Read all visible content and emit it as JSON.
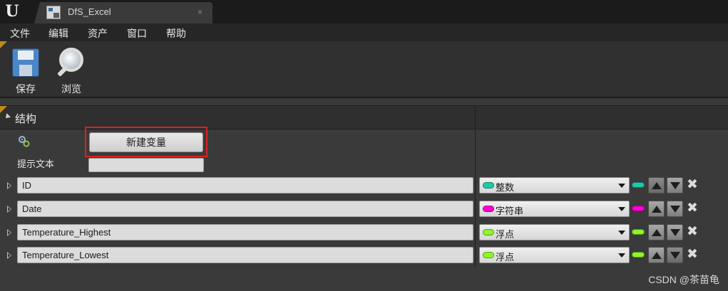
{
  "window": {
    "logo": "U",
    "tab_title": "DfS_Excel",
    "tab_close": "×"
  },
  "menu": [
    "文件",
    "编辑",
    "资产",
    "窗口",
    "帮助"
  ],
  "toolbar": {
    "save_label": "保存",
    "browse_label": "浏览"
  },
  "structure": {
    "header": "结构",
    "new_variable_button": "新建变量",
    "tooltip_label": "提示文本",
    "tooltip_value": ""
  },
  "fields": [
    {
      "name": "ID",
      "type": "整数",
      "type_color": "#1ec9a8"
    },
    {
      "name": "Date",
      "type": "字符串",
      "type_color": "#ff00d4"
    },
    {
      "name": "Temperature_Highest",
      "type": "浮点",
      "type_color": "#8ef52a"
    },
    {
      "name": "Temperature_Lowest",
      "type": "浮点",
      "type_color": "#8ef52a"
    }
  ],
  "watermark": "CSDN @茶苗龟"
}
